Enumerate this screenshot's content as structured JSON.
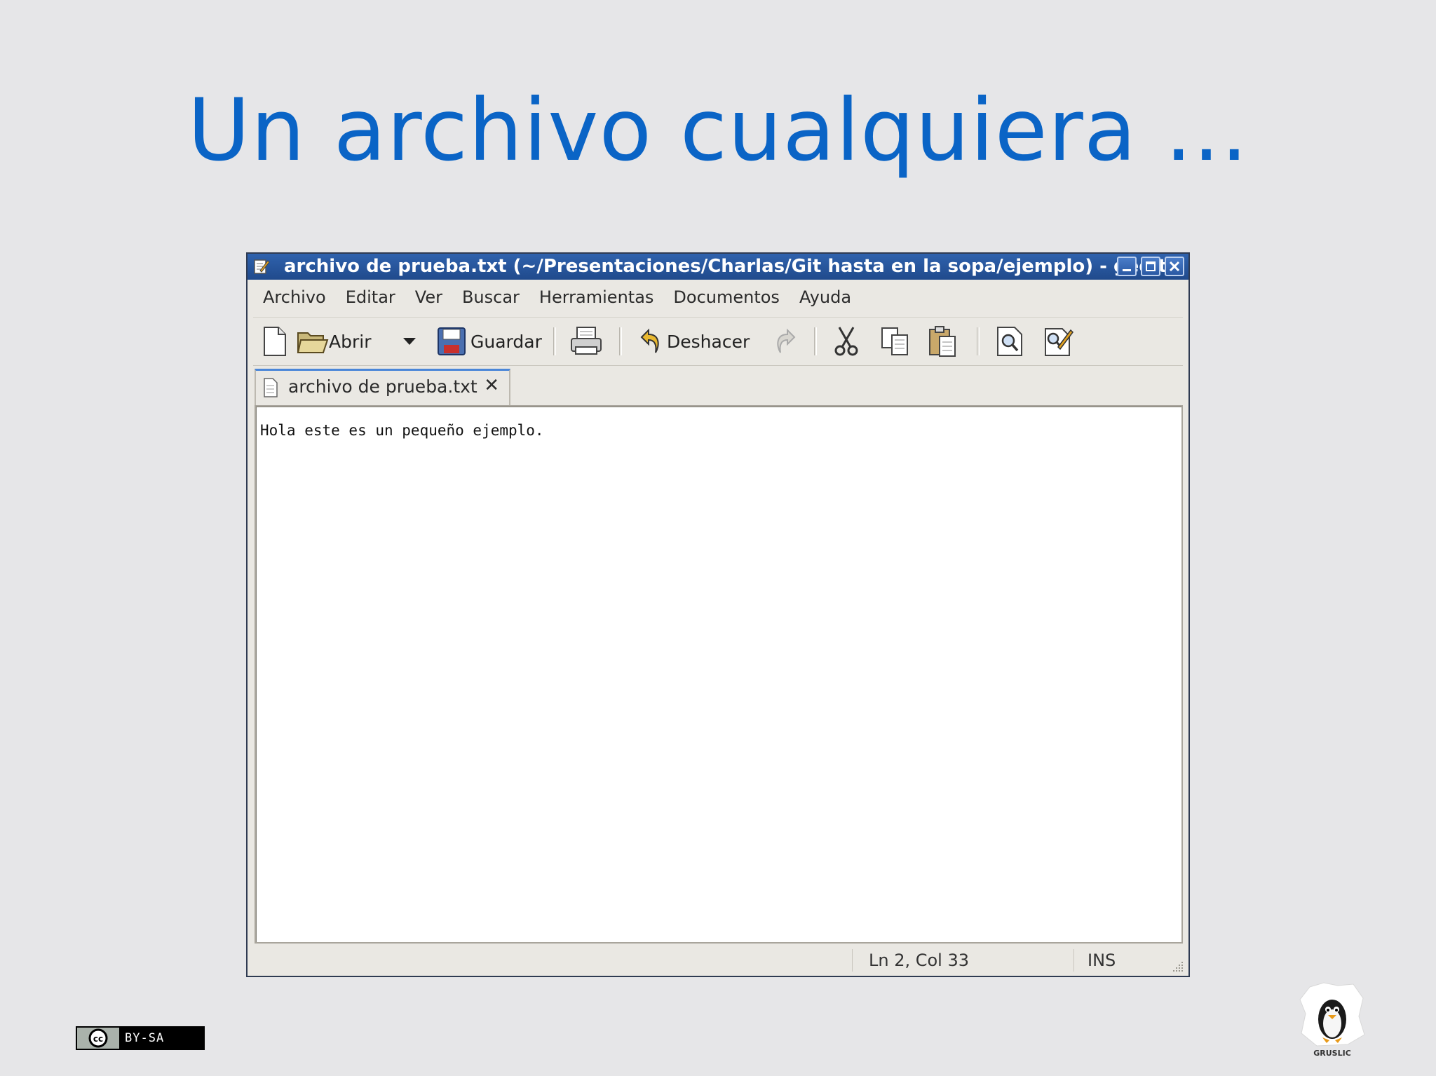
{
  "slide": {
    "title": "Un archivo cualquiera ..."
  },
  "window": {
    "title": "archivo de prueba.txt (~/Presentaciones/Charlas/Git hasta en la sopa/ejemplo) - gedit",
    "menubar": [
      "Archivo",
      "Editar",
      "Ver",
      "Buscar",
      "Herramientas",
      "Documentos",
      "Ayuda"
    ],
    "toolbar": {
      "open_label": "Abrir",
      "save_label": "Guardar",
      "undo_label": "Deshacer"
    },
    "tab": {
      "label": "archivo de prueba.txt",
      "close": "✕"
    },
    "editor": {
      "content": "Hola este es un pequeño ejemplo."
    },
    "statusbar": {
      "position": "Ln 2, Col 33",
      "mode": "INS"
    }
  },
  "footer": {
    "license": "BY-SA",
    "license_logo": "cc",
    "logo_caption": "GRUSLIC"
  },
  "colors": {
    "title": "#0a64c6",
    "titlebar": "#2a57a0",
    "background": "#e6e6e8",
    "window_bg": "#eae8e3"
  }
}
